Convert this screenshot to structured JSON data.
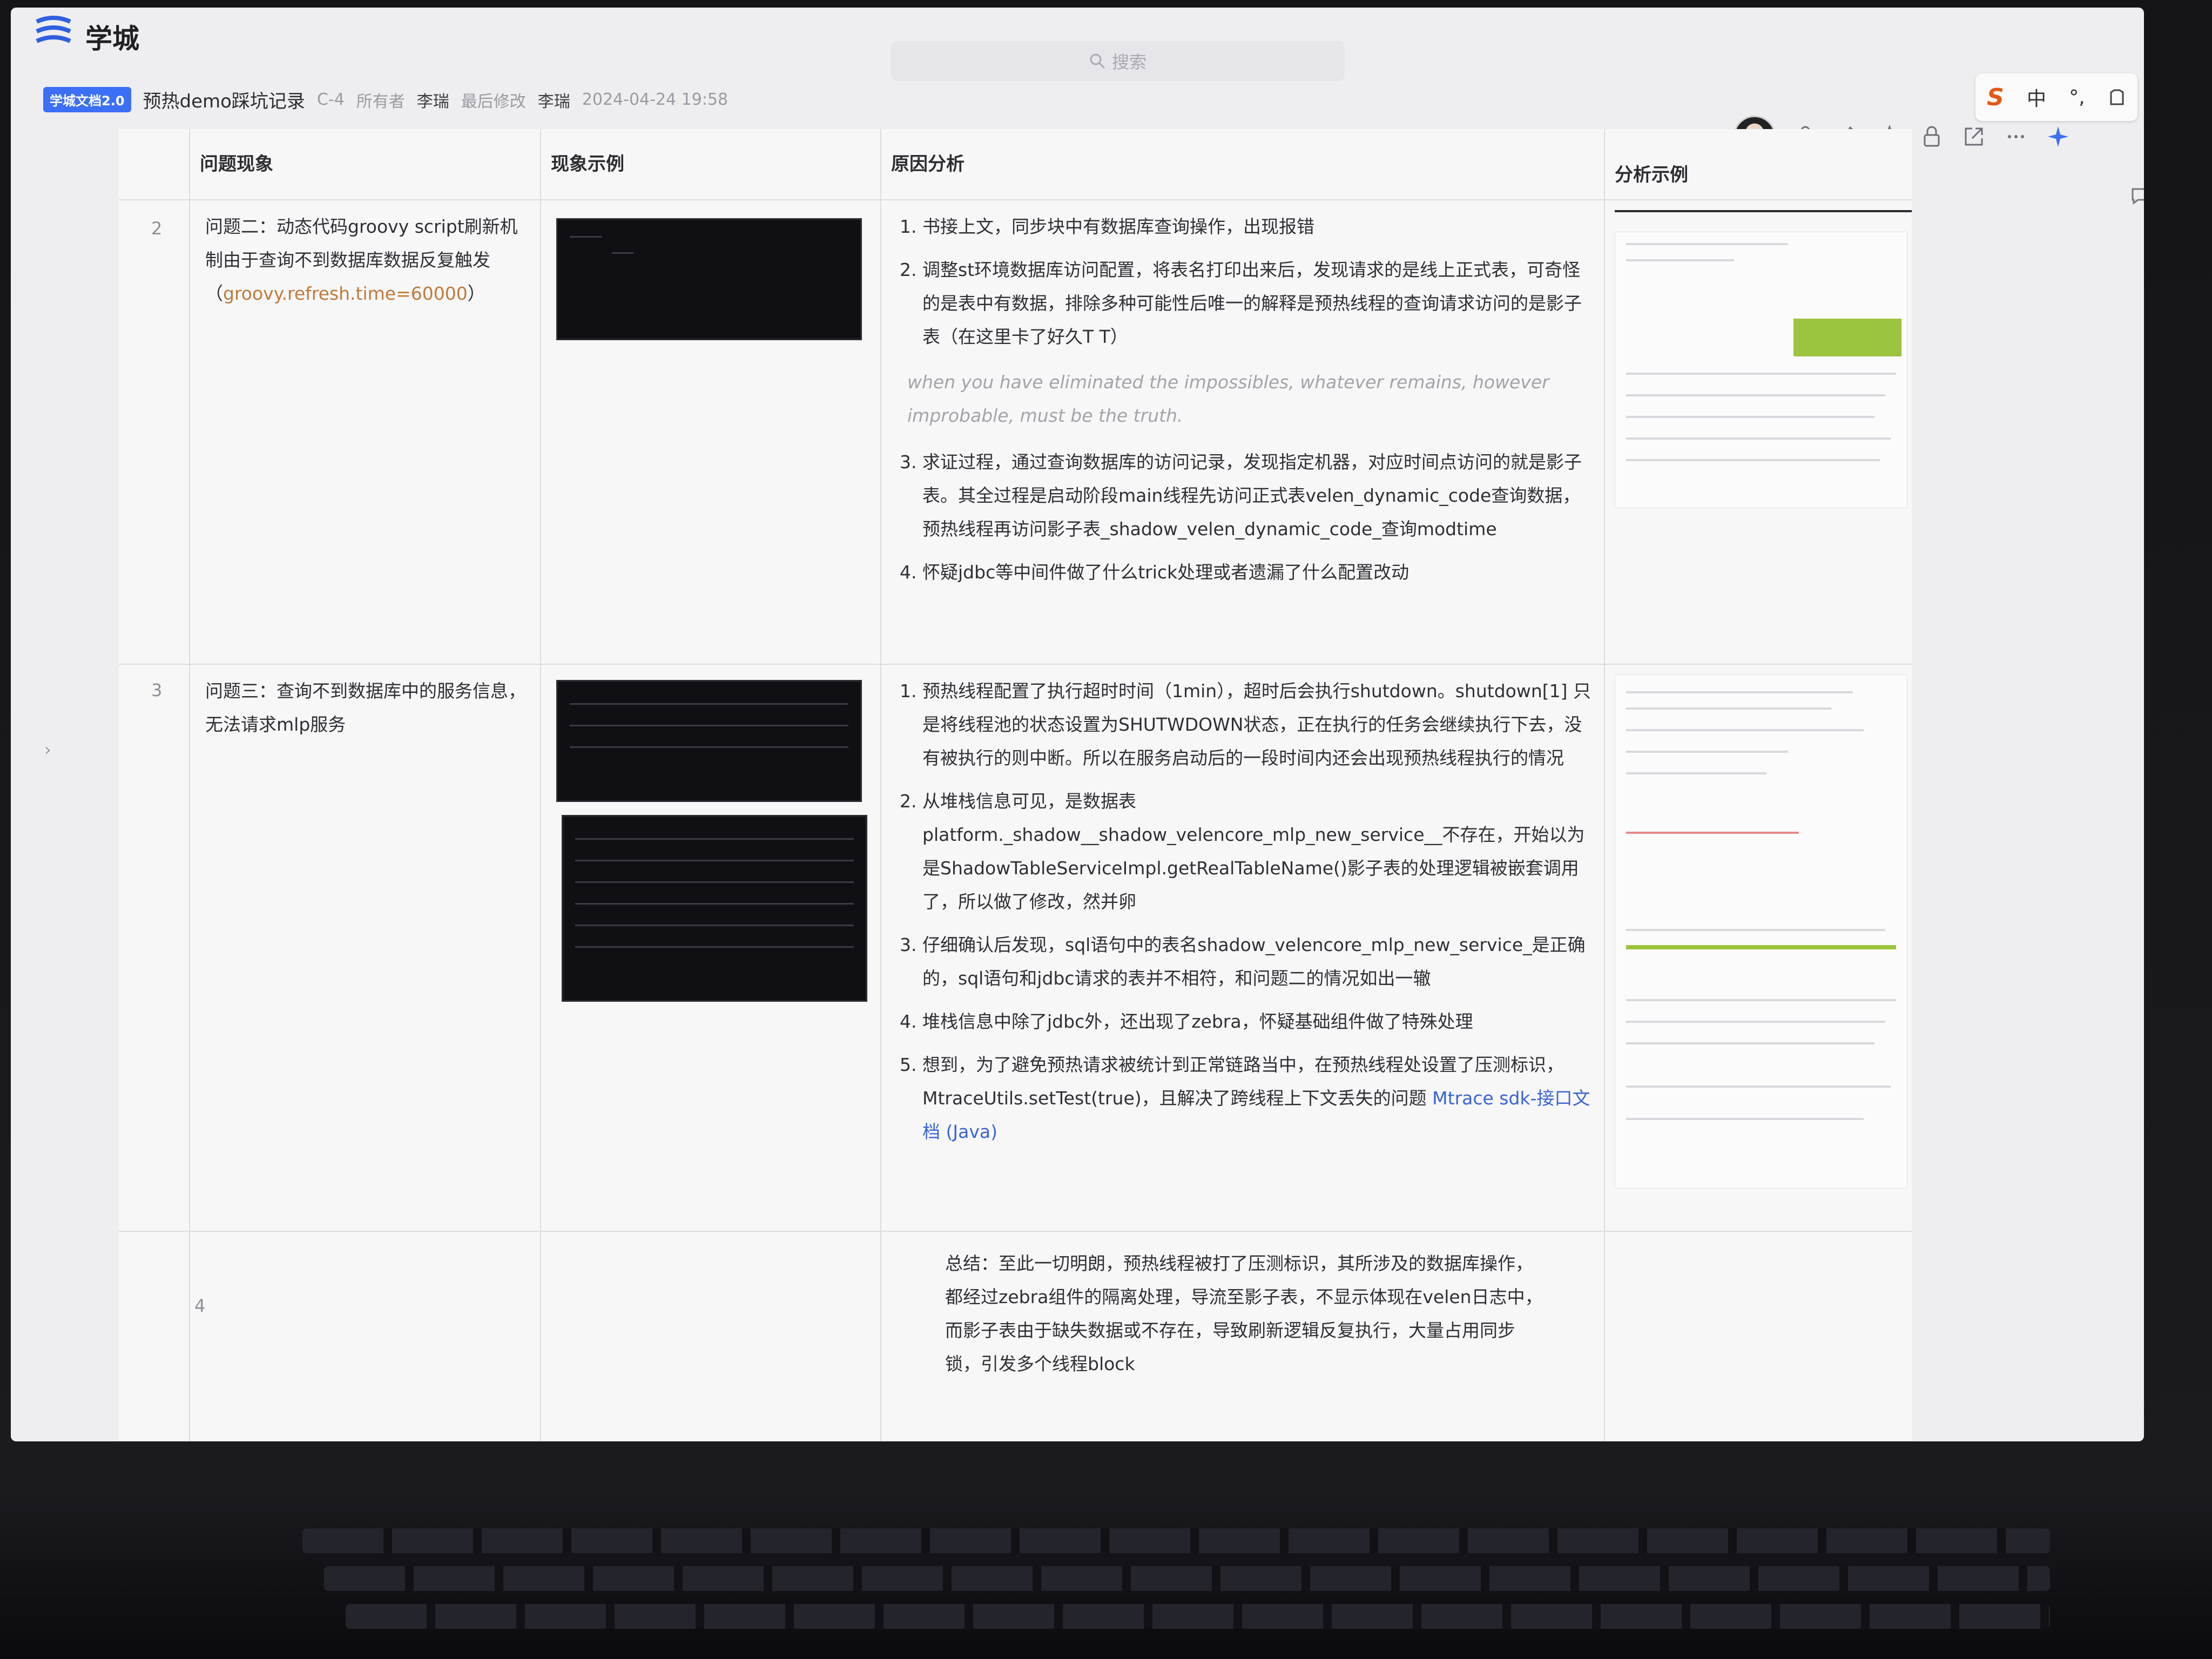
{
  "app": {
    "brand": "学城"
  },
  "search": {
    "placeholder": "搜索"
  },
  "doc": {
    "badge": "学城文档2.0",
    "title": "预热demo踩坑记录",
    "tag": "C-4",
    "owner_label": "所有者",
    "owner": "李瑞",
    "modified_label": "最后修改",
    "modifier": "李瑞",
    "modified_time": "2024-04-24 19:58"
  },
  "ime": {
    "lang": "中",
    "punct": "°,"
  },
  "table": {
    "headers": [
      "问题现象",
      "现象示例",
      "原因分析",
      "分析示例"
    ],
    "rows": [
      {
        "num": "2",
        "issue_prefix": "问题二：动态代码groovy script刷新机制由于查询不到数据库数据反复触发（",
        "issue_code": "groovy.refresh.time=60000",
        "issue_suffix": "）",
        "analysis": [
          "书接上文，同步块中有数据库查询操作，出现报错",
          "调整st环境数据库访问配置，将表名打印出来后，发现请求的是线上正式表，可奇怪的是表中有数据，排除多种可能性后唯一的解释是预热线程的查询请求访问的是影子表（在这里卡了好久T T）"
        ],
        "quote": "when you have eliminated the impossibles, whatever remains, however improbable, must be the truth.",
        "analysis_more": [
          "求证过程，通过查询数据库的访问记录，发现指定机器，对应时间点访问的就是影子表。其全过程是启动阶段main线程先访问正式表velen_dynamic_code查询数据，预热线程再访问影子表_shadow_velen_dynamic_code_查询modtime",
          "怀疑jdbc等中间件做了什么trick处理或者遗漏了什么配置改动"
        ]
      },
      {
        "num": "3",
        "issue": "问题三：查询不到数据库中的服务信息，无法请求mlp服务",
        "analysis": [
          "预热线程配置了执行超时时间（1min），超时后会执行shutdown。shutdown[1] 只是将线程池的状态设置为SHUTWDOWN状态，正在执行的任务会继续执行下去，没有被执行的则中断。所以在服务启动后的一段时间内还会出现预热线程执行的情况",
          "从堆栈信息可见，是数据表platform._shadow__shadow_velencore_mlp_new_service__不存在，开始以为是ShadowTableServiceImpl.getRealTableName()影子表的处理逻辑被嵌套调用了，所以做了修改，然并卵",
          "仔细确认后发现，sql语句中的表名shadow_velencore_mlp_new_service_是正确的，sql语句和jdbc请求的表并不相符，和问题二的情况如出一辙",
          "堆栈信息中除了jdbc外，还出现了zebra，怀疑基础组件做了特殊处理"
        ],
        "item5_text": "想到，为了避免预热请求被统计到正常链路当中，在预热线程处设置了压测标识，MtraceUtils.setTest(true)，且解决了跨线程上下文丢失的问题 ",
        "item5_link": "Mtrace sdk-接口文档 (Java)"
      },
      {
        "num": "4",
        "summary": "总结：至此一切明朗，预热线程被打了压测标识，其所涉及的数据库操作，都经过zebra组件的隔离处理，导流至影子表，不显示体现在velen日志中，而影子表由于缺失数据或不存在，导致刷新逻辑反复执行，大量占用同步锁，引发多个线程block"
      }
    ]
  },
  "icons": [
    "logo-icon",
    "search-icon",
    "share-icon",
    "pin-icon",
    "star-icon",
    "lock-icon",
    "open-external-icon",
    "more-icon",
    "ai-sparkle-icon",
    "comment-icon"
  ]
}
